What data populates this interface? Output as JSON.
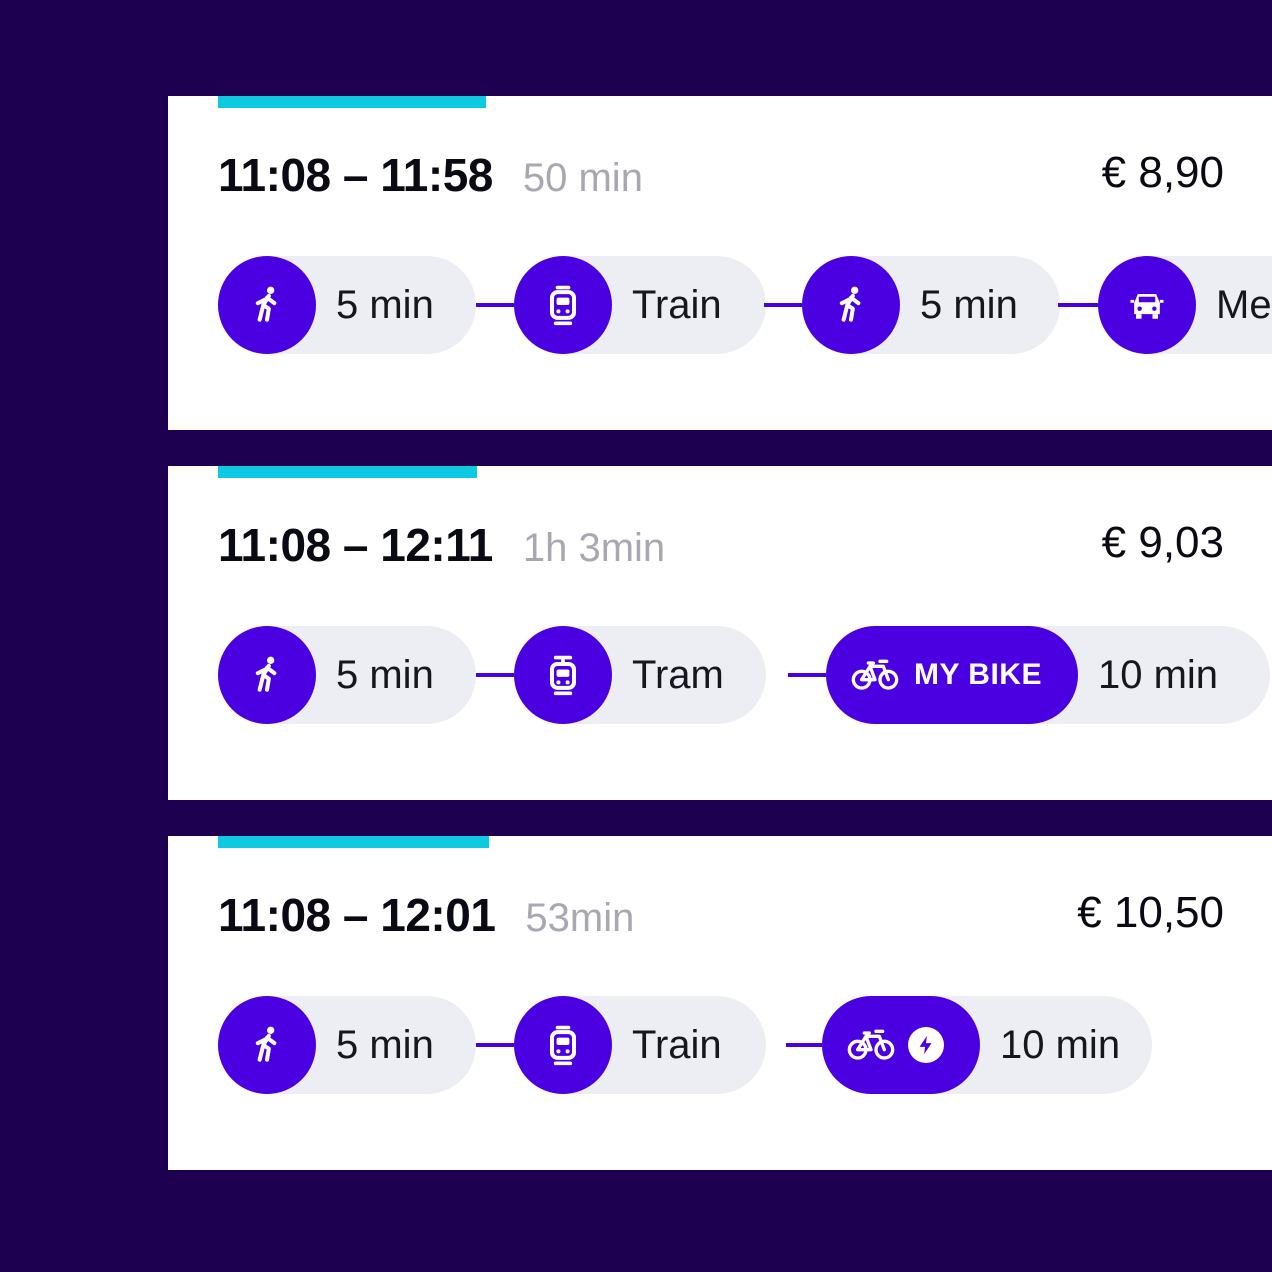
{
  "colors": {
    "background": "#1e0050",
    "card": "#ffffff",
    "accent": "#0ecae0",
    "brand_purple": "#4b00e2",
    "pill_bg": "#eceef3",
    "duration_gray": "#a8a8b2"
  },
  "journeys": [
    {
      "time_range": "11:08 – 11:58",
      "duration": "50 min",
      "price": "€ 8,90",
      "legs": [
        {
          "icon": "walk-icon",
          "label": "5 min"
        },
        {
          "icon": "train-icon",
          "label": "Train"
        },
        {
          "icon": "walk-icon",
          "label": "5 min"
        },
        {
          "icon": "car-icon",
          "label": "Metro"
        }
      ]
    },
    {
      "time_range": "11:08 – 12:11",
      "duration": "1h 3min",
      "price": "€ 9,03",
      "legs": [
        {
          "icon": "walk-icon",
          "label": "5 min"
        },
        {
          "icon": "tram-icon",
          "label": "Tram"
        },
        {
          "icon": "bike-icon",
          "brand": "MY BIKE",
          "label": "10 min"
        }
      ]
    },
    {
      "time_range": "11:08 – 12:01",
      "duration": "53min",
      "price": "€ 10,50",
      "legs": [
        {
          "icon": "walk-icon",
          "label": "5 min"
        },
        {
          "icon": "train-icon",
          "label": "Train"
        },
        {
          "icon": "ebike-icon",
          "badge": "lightning-bolt-icon",
          "label": "10 min"
        }
      ]
    }
  ]
}
